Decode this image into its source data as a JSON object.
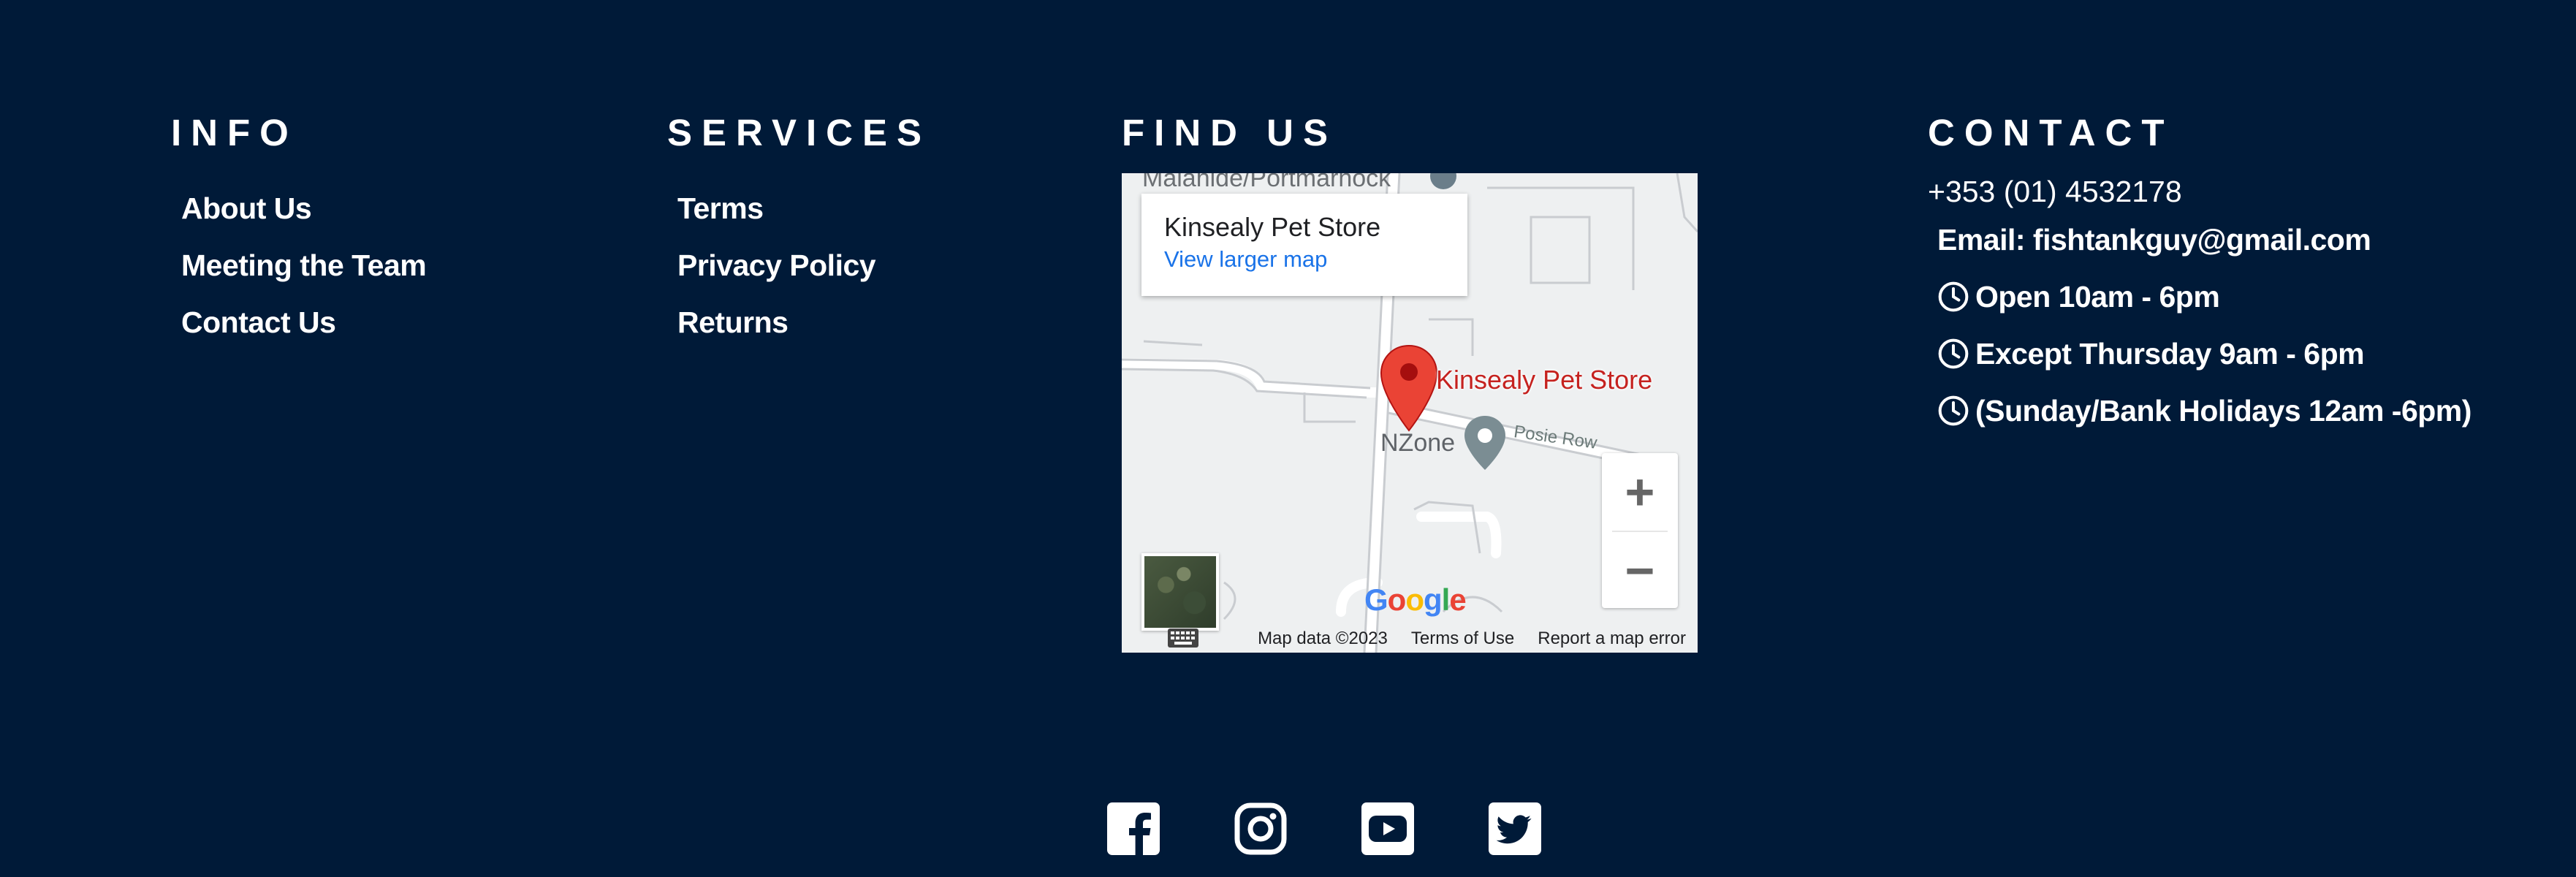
{
  "info": {
    "heading": "INFO",
    "links": [
      "About Us",
      "Meeting the Team",
      "Contact Us"
    ]
  },
  "services": {
    "heading": "SERVICES",
    "links": [
      "Terms",
      "Privacy Policy",
      "Returns"
    ]
  },
  "find_us": {
    "heading": "FIND US",
    "map": {
      "card_title": "Kinsealy Pet Store",
      "card_link": "View larger map",
      "pin_label": "Kinsealy Pet Store",
      "poi_label": "NZone",
      "street_label": "Posie Row",
      "top_street_label": "Malahide/Portmarnock",
      "zoom_in": "+",
      "zoom_out": "−",
      "logo": "Google",
      "map_data": "Map data ©2023",
      "terms": "Terms of Use",
      "report": "Report a map error"
    }
  },
  "contact": {
    "heading": "CONTACT",
    "phone": "+353 (01) 4532178",
    "email": "Email: fishtankguy@gmail.com",
    "hours": [
      "Open 10am - 6pm",
      "Except Thursday 9am - 6pm",
      "(Sunday/Bank Holidays 12am -6pm)"
    ]
  },
  "social": {
    "icons": [
      "facebook-icon",
      "instagram-icon",
      "youtube-icon",
      "twitter-icon"
    ]
  },
  "colors": {
    "background": "#001a38",
    "text": "#ffffff",
    "map_link": "#1a73e8",
    "pin": "#ea4335"
  }
}
